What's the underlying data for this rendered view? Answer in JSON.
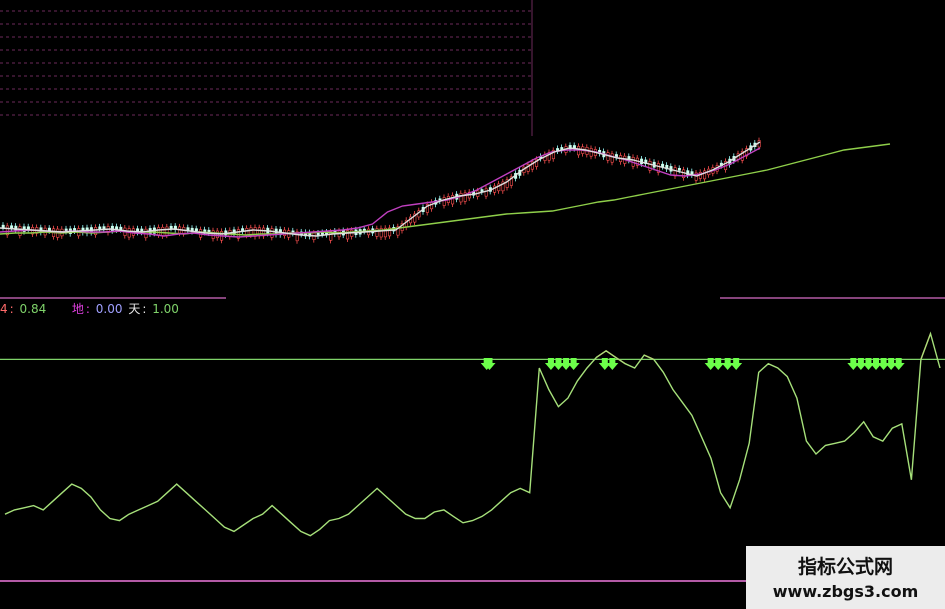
{
  "legend": {
    "item1_name": "4",
    "item1_value": "0.84",
    "item2_name": "地",
    "item2_value": "0.00",
    "item3_name": "天",
    "item3_value": "1.00"
  },
  "watermark": {
    "line1": "指标公式网",
    "line2": "www.zbgs3.com"
  },
  "colors": {
    "background": "#000000",
    "grid": "#6b2a5a",
    "oscillator": "#a6e07a",
    "threshold": "#7fd36a",
    "red_overlay": "#ff3b3b",
    "ma_long": "#8fcf4a",
    "ma_mid": "#c040c0",
    "ma_short": "#e0e0e0",
    "marker": "#6cff4a"
  },
  "chart_data": [
    {
      "type": "line",
      "title": "",
      "series": [
        {
          "values": [
            234,
            233,
            233,
            232,
            233,
            232,
            233,
            232,
            231,
            232,
            232,
            233,
            234,
            232,
            233,
            234,
            235,
            234,
            234,
            233,
            233,
            232,
            233,
            232,
            231,
            230,
            228,
            226,
            224,
            222,
            220,
            218,
            216,
            214,
            213,
            212,
            211,
            208,
            205,
            202,
            200,
            197,
            194,
            191,
            188,
            185,
            182,
            179,
            176,
            173,
            170,
            166,
            162,
            158,
            154,
            150,
            148,
            146,
            144
          ]
        },
        {
          "values": [
            232,
            231,
            230,
            231,
            232,
            231,
            232,
            232,
            231,
            233,
            234,
            236,
            234,
            233,
            235,
            236,
            237,
            236,
            235,
            234,
            233,
            232,
            231,
            230,
            228,
            224,
            212,
            206,
            204,
            202,
            200,
            196,
            190,
            182,
            174,
            166,
            158,
            152,
            150,
            150,
            152,
            156,
            160,
            165,
            170,
            175,
            176,
            174,
            170,
            164,
            156,
            148
          ]
        },
        {
          "values": [
            228,
            229,
            230,
            231,
            232,
            231,
            230,
            229,
            231,
            232,
            230,
            229,
            231,
            233,
            234,
            232,
            230,
            231,
            233,
            235,
            236,
            234,
            233,
            232,
            231,
            230,
            218,
            206,
            200,
            196,
            194,
            190,
            182,
            170,
            160,
            152,
            148,
            150,
            154,
            158,
            160,
            164,
            168,
            172,
            176,
            170,
            162,
            152,
            142
          ]
        }
      ]
    },
    {
      "type": "line",
      "title": "",
      "threshold": 0.84,
      "series": [
        {
          "values": [
            0.12,
            0.14,
            0.15,
            0.16,
            0.14,
            0.18,
            0.22,
            0.26,
            0.24,
            0.2,
            0.14,
            0.1,
            0.09,
            0.12,
            0.14,
            0.16,
            0.18,
            0.22,
            0.26,
            0.22,
            0.18,
            0.14,
            0.1,
            0.06,
            0.04,
            0.07,
            0.1,
            0.12,
            0.16,
            0.12,
            0.08,
            0.04,
            0.02,
            0.05,
            0.09,
            0.1,
            0.12,
            0.16,
            0.2,
            0.24,
            0.2,
            0.16,
            0.12,
            0.1,
            0.1,
            0.13,
            0.14,
            0.11,
            0.08,
            0.09,
            0.11,
            0.14,
            0.18,
            0.22,
            0.24,
            0.22,
            0.8,
            0.7,
            0.62,
            0.66,
            0.74,
            0.8,
            0.85,
            0.88,
            0.85,
            0.82,
            0.8,
            0.86,
            0.84,
            0.78,
            0.7,
            0.64,
            0.58,
            0.48,
            0.38,
            0.22,
            0.15,
            0.28,
            0.45,
            0.78,
            0.82,
            0.8,
            0.76,
            0.66,
            0.46,
            0.4,
            0.44,
            0.45,
            0.46,
            0.5,
            0.55,
            0.48,
            0.46,
            0.52,
            0.54,
            0.28,
            0.84,
            0.96,
            0.8
          ]
        }
      ],
      "signal_groups": [
        [
          0.515,
          0.518
        ],
        [
          0.583,
          0.591,
          0.599,
          0.607
        ],
        [
          0.64,
          0.648
        ],
        [
          0.752,
          0.76,
          0.77,
          0.779
        ],
        [
          0.903,
          0.911,
          0.919,
          0.927,
          0.935,
          0.943,
          0.951
        ]
      ]
    }
  ]
}
